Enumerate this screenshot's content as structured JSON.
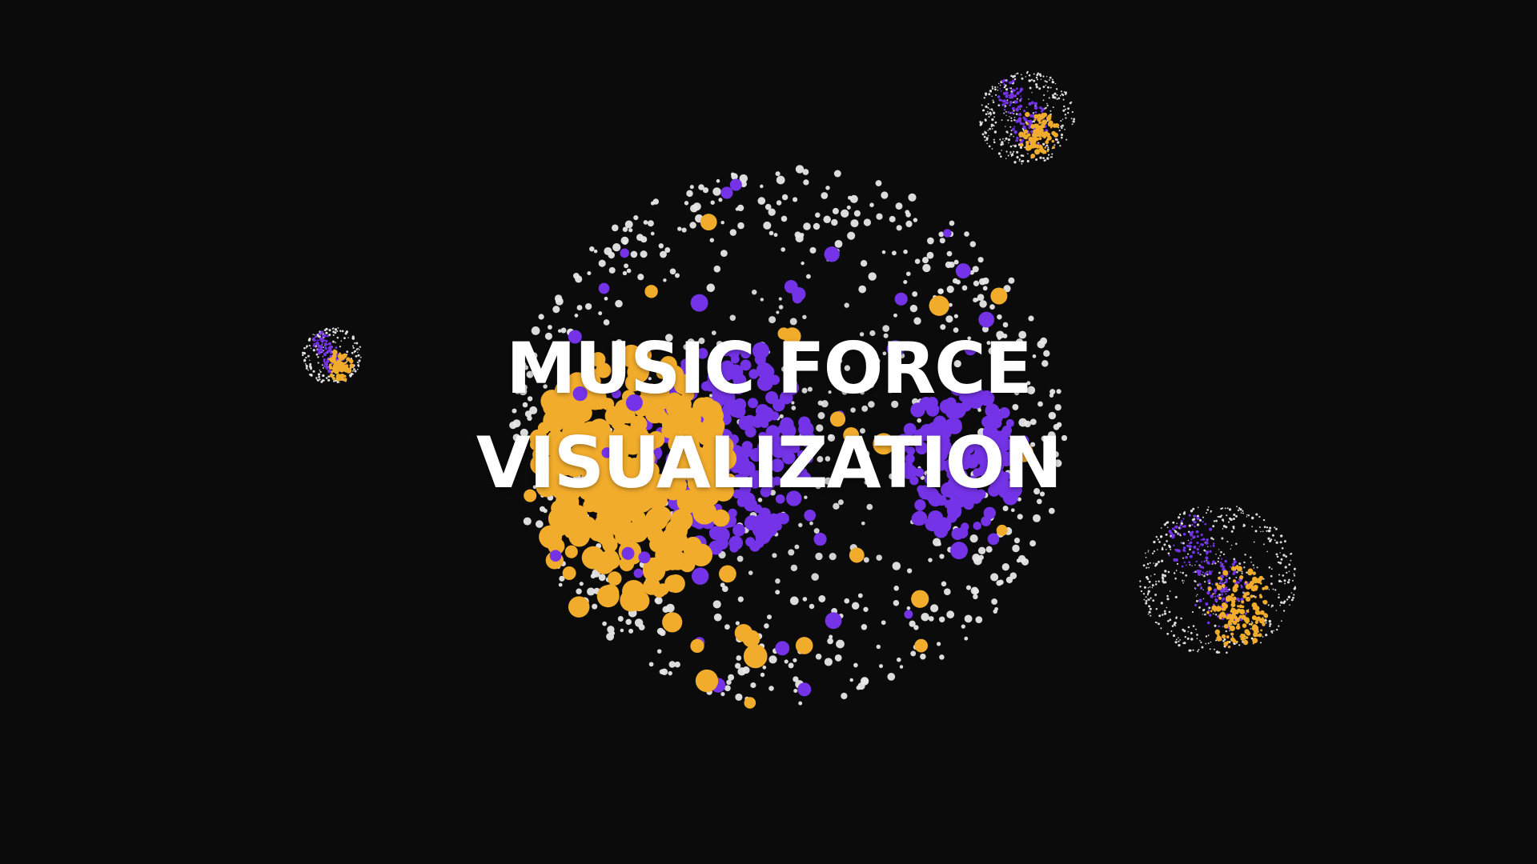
{
  "title": {
    "line1": "MUSIC FORCE",
    "line2": "VISUALIZATION"
  },
  "palette": {
    "background": "#0b0b0b",
    "white": "#e8e8e8",
    "orange": "#f2ac2c",
    "purple": "#7433e6"
  },
  "clusters": [
    {
      "name": "main-sphere",
      "category_mix": [
        "white",
        "orange",
        "purple"
      ]
    },
    {
      "name": "small-sphere-left",
      "category_mix": [
        "white",
        "orange",
        "purple"
      ]
    },
    {
      "name": "small-sphere-top-right",
      "category_mix": [
        "white",
        "orange",
        "purple"
      ]
    },
    {
      "name": "medium-sphere-right",
      "category_mix": [
        "white",
        "orange",
        "purple"
      ]
    }
  ]
}
